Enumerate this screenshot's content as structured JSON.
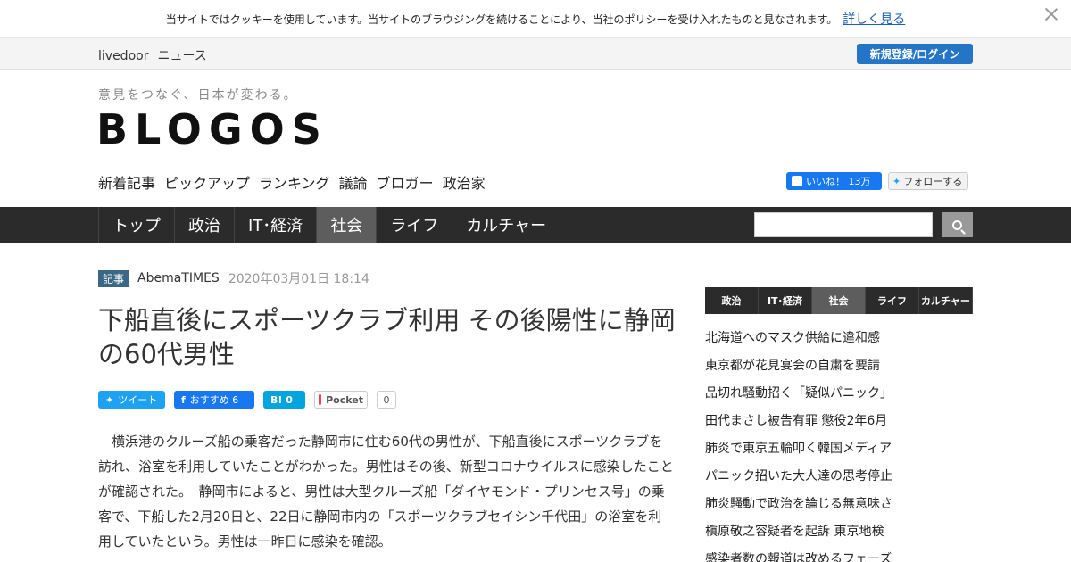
{
  "cookie": {
    "message": "当サイトではクッキーを使用しています。当サイトのブラウジングを続けることにより、当社のポリシーを受け入れたものと見なされます。",
    "link": "詳しく見る"
  },
  "ldbar": {
    "brand": "livedoor",
    "news": "ニュース",
    "login": "新規登録/ログイン"
  },
  "header": {
    "tagline": "意見をつなぐ、日本が変わる。",
    "logo": "BLOGOS",
    "subnav": [
      "新着記事",
      "ピックアップ",
      "ランキング",
      "議論",
      "ブロガー",
      "政治家"
    ],
    "fb_like": "いいね！ 13万",
    "tw_follow": "フォローする"
  },
  "nav": {
    "items": [
      "トップ",
      "政治",
      "IT･経済",
      "社会",
      "ライフ",
      "カルチャー"
    ],
    "active_index": 3
  },
  "article": {
    "badge": "記事",
    "source": "AbemaTIMES",
    "date": "2020年03月01日 18:14",
    "title": "下船直後にスポーツクラブ利用 その後陽性に静岡の60代男性",
    "share": {
      "tweet": "ツイート",
      "fb": "おすすめ 6",
      "hatena": "B! 0",
      "pocket": "Pocket",
      "pocket_count": "0"
    },
    "body": "横浜港のクルーズ船の乗客だった静岡市に住む60代の男性が、下船直後にスポーツクラブを訪れ、浴室を利用していたことがわかった。男性はその後、新型コロナウイルスに感染したことが確認された。　静岡市によると、男性は大型クルーズ船「ダイヤモンド・プリンセス号」の乗客で、下船した2月20日と、22日に静岡市内の「スポーツクラブセイシン千代田」の浴室を利用していたという。男性は一昨日に感染を確認。"
  },
  "sidebar": {
    "tabs": [
      "政治",
      "IT･経済",
      "社会",
      "ライフ",
      "カルチャー"
    ],
    "active_index": 2,
    "items": [
      "北海道へのマスク供給に違和感",
      "東京都が花見宴会の自粛を要請",
      "品切れ騒動招く「疑似パニック」",
      "田代まさし被告有罪 懲役2年6月",
      "肺炎で東京五輪叩く韓国メディア",
      "パニック招いた大人達の思考停止",
      "肺炎騒動で政治を論じる無意味さ",
      "槇原敬之容疑者を起訴 東京地検",
      "感染者数の報道は改めるフェーズ"
    ]
  }
}
